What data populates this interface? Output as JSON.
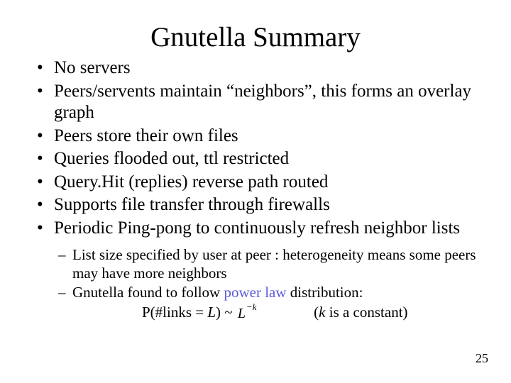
{
  "title": "Gnutella Summary",
  "bullets": [
    "No servers",
    "Peers/servents maintain “neighbors”, this forms an overlay graph",
    "Peers store their own files",
    "Queries flooded out, ttl restricted",
    "Query.Hit (replies) reverse path routed",
    "Supports file transfer through firewalls",
    "Periodic Ping-pong to continuously refresh neighbor lists"
  ],
  "sublist": {
    "item0": "List size specified by user at peer : heterogeneity means some peers may have more neighbors",
    "item1_prefix": "Gnutella found to follow ",
    "item1_highlight": "power law",
    "item1_suffix": " distribution:"
  },
  "formula": {
    "lhs": "P(#links = ",
    "L": "L",
    "paren_tilde": ") ~ ",
    "k_prefix": "(",
    "k": "k",
    "k_suffix": " is a constant)"
  },
  "page_number": "25"
}
